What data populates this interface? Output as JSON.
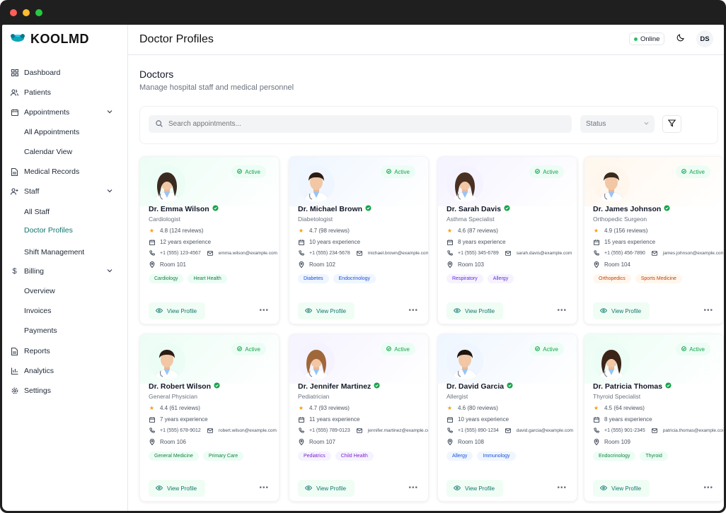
{
  "app": {
    "brand": "KOOLMD"
  },
  "sidebar": {
    "items": [
      {
        "label": "Dashboard",
        "icon": "grid-icon"
      },
      {
        "label": "Patients",
        "icon": "users-icon"
      },
      {
        "label": "Appointments",
        "icon": "calendar-icon"
      },
      {
        "label": "All Appointments"
      },
      {
        "label": "Calendar View"
      },
      {
        "label": "Medical Records",
        "icon": "document-icon"
      },
      {
        "label": "Staff",
        "icon": "user-plus-icon"
      },
      {
        "label": "All Staff"
      },
      {
        "label": "Doctor Profiles"
      },
      {
        "label": "Shift Management"
      },
      {
        "label": "Billing",
        "icon": "dollar-icon"
      },
      {
        "label": "Overview"
      },
      {
        "label": "Invoices"
      },
      {
        "label": "Payments"
      },
      {
        "label": "Reports",
        "icon": "document-icon"
      },
      {
        "label": "Analytics",
        "icon": "bar-chart-icon"
      },
      {
        "label": "Settings",
        "icon": "gear-icon"
      }
    ]
  },
  "header": {
    "title": "Doctor Profiles",
    "status": "Online",
    "user_initials": "DS"
  },
  "page": {
    "title": "Doctors",
    "subtitle": "Manage hospital staff and medical personnel"
  },
  "filters": {
    "search_placeholder": "Search appointments...",
    "status_label": "Status"
  },
  "card_labels": {
    "view_profile": "View Profile"
  },
  "doctors": [
    {
      "name": "Dr. Emma Wilson",
      "specialty": "Cardiologist",
      "status": "Active",
      "rating": "4.8 (124 reviews)",
      "experience": "12 years experience",
      "phone": "+1 (555) 123-4567",
      "email": "emma.wilson@example.com",
      "room": "Room 101",
      "tags": [
        "Cardiology",
        "Heart Health"
      ],
      "tag_color": "#ecfdf5",
      "tag_text": "#15803d",
      "bg": "#ecfdf5",
      "hair": "#3b2a20",
      "gender": "f"
    },
    {
      "name": "Dr. Michael Brown",
      "specialty": "Diabetologist",
      "status": "Active",
      "rating": "4.7 (98 reviews)",
      "experience": "10 years experience",
      "phone": "+1 (555) 234-5678",
      "email": "michael.brown@example.com",
      "room": "Room 102",
      "tags": [
        "Diabetes",
        "Endocrinology"
      ],
      "tag_color": "#eff6ff",
      "tag_text": "#1d4ed8",
      "bg": "#eff6ff",
      "hair": "#2b1d14",
      "gender": "m"
    },
    {
      "name": "Dr. Sarah Davis",
      "specialty": "Asthma Specialist",
      "status": "Active",
      "rating": "4.6 (87 reviews)",
      "experience": "8 years experience",
      "phone": "+1 (555) 345-6789",
      "email": "sarah.davis@example.com",
      "room": "Room 103",
      "tags": [
        "Respiratory",
        "Allergy"
      ],
      "tag_color": "#f5f3ff",
      "tag_text": "#6d28d9",
      "bg": "#f5f3ff",
      "hair": "#4a3022",
      "gender": "f"
    },
    {
      "name": "Dr. James Johnson",
      "specialty": "Orthopedic Surgeon",
      "status": "Active",
      "rating": "4.9 (156 reviews)",
      "experience": "15 years experience",
      "phone": "+1 (555) 456-7890",
      "email": "james.johnson@example.com",
      "room": "Room 104",
      "tags": [
        "Orthopedics",
        "Sports Medicine"
      ],
      "tag_color": "#fff7ed",
      "tag_text": "#c2410c",
      "bg": "#fff7ed",
      "hair": "#3a2a1c",
      "gender": "m"
    },
    {
      "name": "Dr. Robert Wilson",
      "specialty": "General Physician",
      "status": "Active",
      "rating": "4.4 (61 reviews)",
      "experience": "7 years experience",
      "phone": "+1 (555) 678-9012",
      "email": "robert.wilson@example.com",
      "room": "Room 106",
      "tags": [
        "General Medicine",
        "Primary Care"
      ],
      "tag_color": "#ecfdf5",
      "tag_text": "#15803d",
      "bg": "#ecfdf5",
      "hair": "#2b1d14",
      "gender": "m"
    },
    {
      "name": "Dr. Jennifer Martinez",
      "specialty": "Pediatrician",
      "status": "Active",
      "rating": "4.7 (93 reviews)",
      "experience": "11 years experience",
      "phone": "+1 (555) 789-0123",
      "email": "jennifer.martinez@example.com",
      "room": "Room 107",
      "tags": [
        "Pediatrics",
        "Child Health"
      ],
      "tag_color": "#f5f3ff",
      "tag_text": "#7e22ce",
      "bg": "#f5f3ff",
      "hair": "#a0673a",
      "gender": "f"
    },
    {
      "name": "Dr. David Garcia",
      "specialty": "Allergist",
      "status": "Active",
      "rating": "4.6 (80 reviews)",
      "experience": "10 years experience",
      "phone": "+1 (555) 890-1234",
      "email": "david.garcia@example.com",
      "room": "Room 108",
      "tags": [
        "Allergy",
        "Immunology"
      ],
      "tag_color": "#eff6ff",
      "tag_text": "#1d4ed8",
      "bg": "#eff6ff",
      "hair": "#1f1510",
      "gender": "m"
    },
    {
      "name": "Dr. Patricia Thomas",
      "specialty": "Thyroid Specialist",
      "status": "Active",
      "rating": "4.5 (64 reviews)",
      "experience": "8 years experience",
      "phone": "+1 (555) 901-2345",
      "email": "patricia.thomas@example.com",
      "room": "Room 109",
      "tags": [
        "Endocrinology",
        "Thyroid"
      ],
      "tag_color": "#ecfdf5",
      "tag_text": "#15803d",
      "bg": "#ecfdf5",
      "hair": "#3b2418",
      "gender": "f"
    }
  ],
  "colors": {
    "accent": "#0f766e",
    "active": "#16a34a",
    "star": "#f59e0b"
  }
}
